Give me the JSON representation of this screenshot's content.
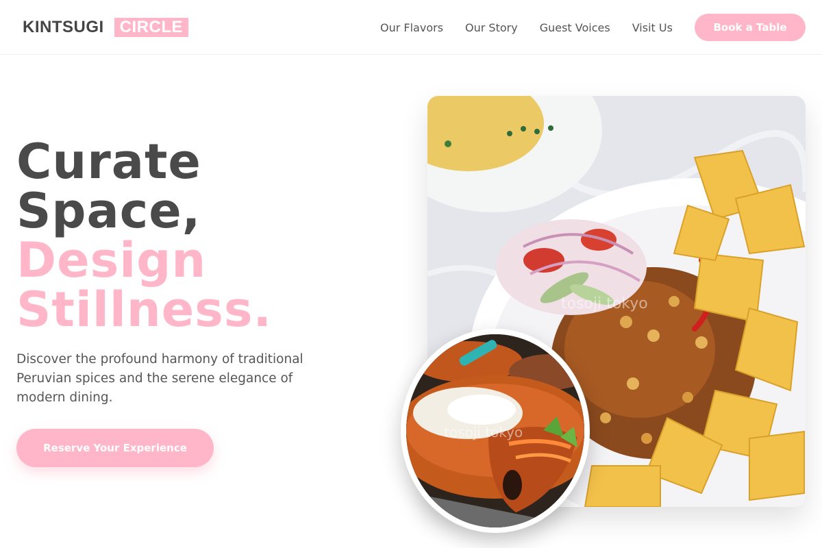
{
  "brand": {
    "name": "KINTSUGI",
    "accent": "CIRCLE"
  },
  "nav": {
    "items": [
      "Our Flavors",
      "Our Story",
      "Guest Voices",
      "Visit Us"
    ],
    "cta": "Book a Table"
  },
  "hero": {
    "line1": "Curate",
    "line2": "Space,",
    "line3": "Design",
    "line4": "Stillness.",
    "description": "Discover the profound harmony of traditional Peruvian spices and the serene elegance of modern dining.",
    "cta": "Reserve Your Experience"
  },
  "images": {
    "main_watermark": "tosoji tokyo",
    "inset_watermark": "tosoji tokyo"
  },
  "colors": {
    "accent": "#ffb6c8",
    "text_dark": "#4a4a4a",
    "text_body": "#555555",
    "background": "#ffffff"
  }
}
